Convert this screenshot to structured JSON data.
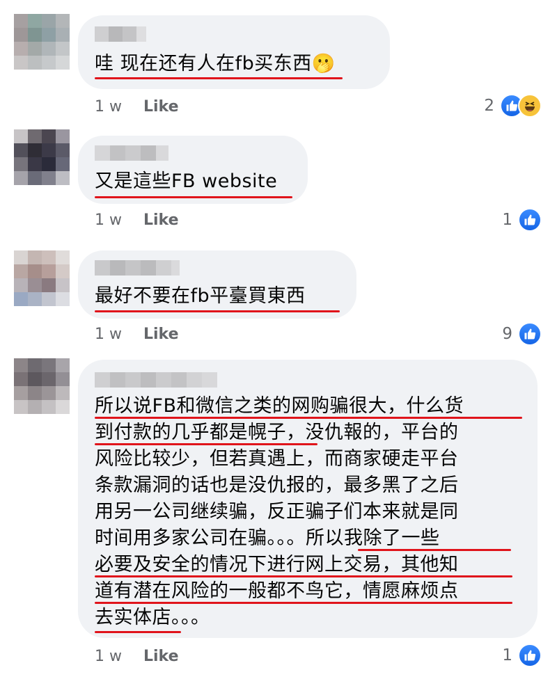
{
  "comments": [
    {
      "lines": [
        "哇 现在还有人在fb买东西🫢"
      ],
      "time": "1 w",
      "like_label": "Like",
      "reaction_count": "2",
      "reactions": [
        "like-icon",
        "haha-icon"
      ]
    },
    {
      "lines": [
        "又是這些FB website"
      ],
      "time": "1 w",
      "like_label": "Like",
      "reaction_count": "1",
      "reactions": [
        "like-icon"
      ]
    },
    {
      "lines": [
        "最好不要在fb平臺買東西"
      ],
      "time": "1 w",
      "like_label": "Like",
      "reaction_count": "9",
      "reactions": [
        "like-icon"
      ]
    },
    {
      "lines": [
        "所以说FB和微信之类的网购骗很大，什么货",
        "到付款的几乎都是幌子，没仇報的，平台的",
        "风险比较少，但若真遇上，而商家硬走平台",
        "条款漏洞的话也是没仇报的，最多黑了之后",
        "用另一公司继续骗，反正骗子们本来就是同",
        "时间用多家公司在骗。。。所以我除了一些",
        "必要及安全的情况下进行网上交易，其他知",
        "道有潜在风险的一般都不鸟它，情愿麻烦点",
        "去实体店。。。"
      ],
      "time": "1 w",
      "like_label": "Like",
      "reaction_count": "1",
      "reactions": [
        "like-icon"
      ]
    }
  ],
  "colors": {
    "bubble": "#f0f2f5",
    "underline": "#e0141b",
    "meta_text": "#65676b",
    "like_blue": "#1877f2"
  }
}
